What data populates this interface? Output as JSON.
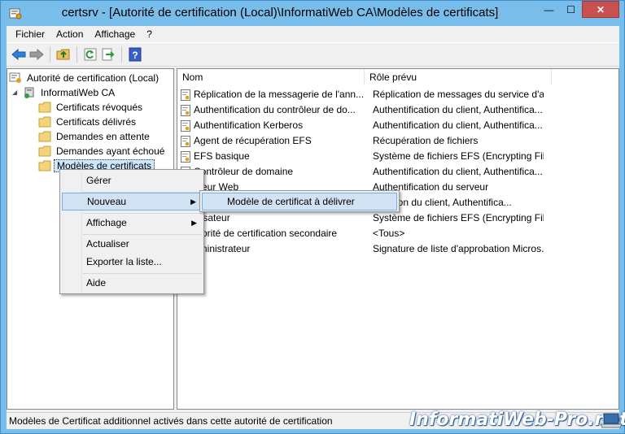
{
  "window": {
    "title": "certsrv - [Autorité de certification (Local)\\InformatiWeb CA\\Modèles de certificats]",
    "minimize": "—",
    "maximize": "☐",
    "close": "✕"
  },
  "menubar": [
    "Fichier",
    "Action",
    "Affichage",
    "?"
  ],
  "toolbar": {
    "buttons": [
      "back-icon",
      "forward-icon",
      "up-folder-icon",
      "refresh-icon",
      "export-icon",
      "help-icon"
    ]
  },
  "tree": {
    "root": "Autorité de certification (Local)",
    "ca": "InformatiWeb CA",
    "children": [
      "Certificats révoqués",
      "Certificats délivrés",
      "Demandes en attente",
      "Demandes ayant échoué",
      "Modèles de certificats"
    ]
  },
  "list": {
    "columns": [
      "Nom",
      "Rôle prévu"
    ],
    "rows": [
      {
        "name": "Réplication de la messagerie de l'ann...",
        "role": "Réplication de messages du service d'a..."
      },
      {
        "name": "Authentification du contrôleur de do...",
        "role": "Authentification du client, Authentifica..."
      },
      {
        "name": "Authentification Kerberos",
        "role": "Authentification du client, Authentifica..."
      },
      {
        "name": "Agent de récupération EFS",
        "role": "Récupération de fichiers"
      },
      {
        "name": "EFS basique",
        "role": "Système de fichiers EFS (Encrypting File..."
      },
      {
        "name": "Contrôleur de domaine",
        "role": "Authentification du client, Authentifica..."
      },
      {
        "name": "rveur Web",
        "role": "Authentification du serveur"
      },
      {
        "name": "",
        "role": "tification du client, Authentifica..."
      },
      {
        "name": "tilisateur",
        "role": "Système de fichiers EFS (Encrypting File..."
      },
      {
        "name": "utorité de certification secondaire",
        "role": "<Tous>"
      },
      {
        "name": "dministrateur",
        "role": "Signature de liste d'approbation Micros..."
      }
    ]
  },
  "context_menu": {
    "items": [
      "Gérer",
      "Nouveau",
      "Affichage",
      "Actualiser",
      "Exporter la liste...",
      "Aide"
    ],
    "arrow": "▶"
  },
  "submenu": {
    "item": "Modèle de certificat à délivrer"
  },
  "status": "Modèles de Certificat additionnel activés dans cette autorité de certification",
  "watermark": "InformatiWeb-Pro.net"
}
